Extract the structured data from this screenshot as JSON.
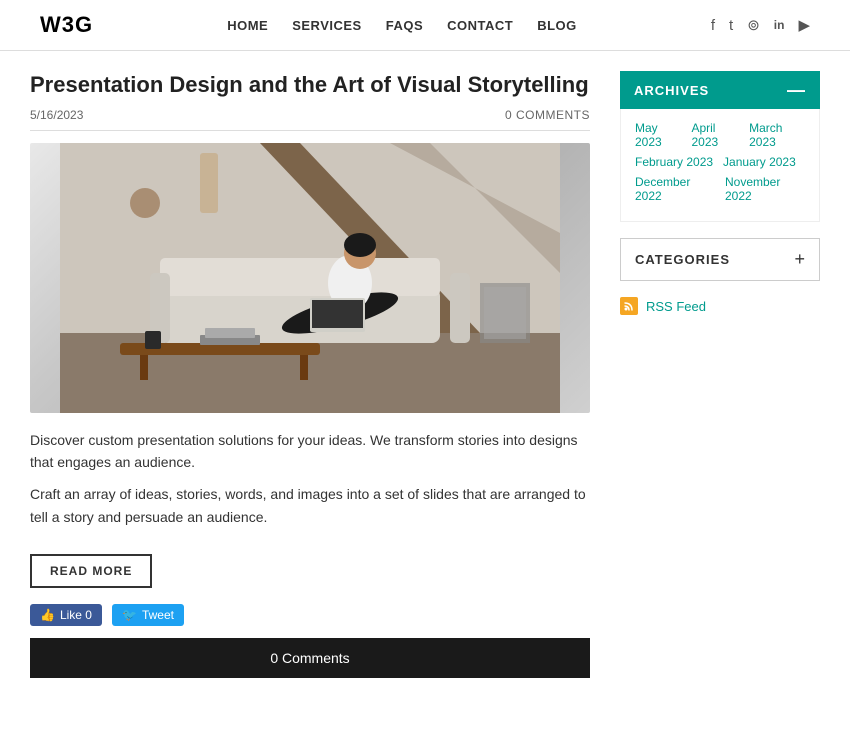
{
  "header": {
    "logo": "W3G",
    "nav": [
      {
        "label": "HOME",
        "id": "home"
      },
      {
        "label": "SERVICES",
        "id": "services"
      },
      {
        "label": "FAQS",
        "id": "faqs"
      },
      {
        "label": "CONTACT",
        "id": "contact"
      },
      {
        "label": "BLOG",
        "id": "blog"
      }
    ],
    "social": [
      {
        "id": "facebook",
        "icon": "f"
      },
      {
        "id": "twitter",
        "icon": "t"
      },
      {
        "id": "instagram",
        "icon": "i"
      },
      {
        "id": "linkedin",
        "icon": "in"
      },
      {
        "id": "youtube",
        "icon": "yt"
      }
    ]
  },
  "post": {
    "title": "Presentation Design and the Art of Visual Storytelling",
    "date": "5/16/2023",
    "comments_count": "0 COMMENTS",
    "excerpt1": "Discover custom presentation solutions for your ideas. We transform stories into designs that engages an audience.",
    "excerpt2": "Craft an array of ideas, stories, words, and images into a set of slides that are arranged to tell a story and persuade an audience.",
    "read_more_label": "READ MORE",
    "fb_label": "Like 0",
    "tweet_label": "Tweet",
    "comments_bar": "0 Comments"
  },
  "sidebar": {
    "archives_title": "ARCHIVES",
    "archives_minus": "—",
    "archive_links": [
      {
        "label": "May 2023",
        "row": 0
      },
      {
        "label": "April 2023",
        "row": 0
      },
      {
        "label": "March 2023",
        "row": 0
      },
      {
        "label": "February 2023",
        "row": 1
      },
      {
        "label": "January 2023",
        "row": 1
      },
      {
        "label": "December 2022",
        "row": 2
      },
      {
        "label": "November 2022",
        "row": 2
      }
    ],
    "categories_label": "CATEGORIES",
    "categories_plus": "+",
    "rss_label": "RSS Feed"
  }
}
